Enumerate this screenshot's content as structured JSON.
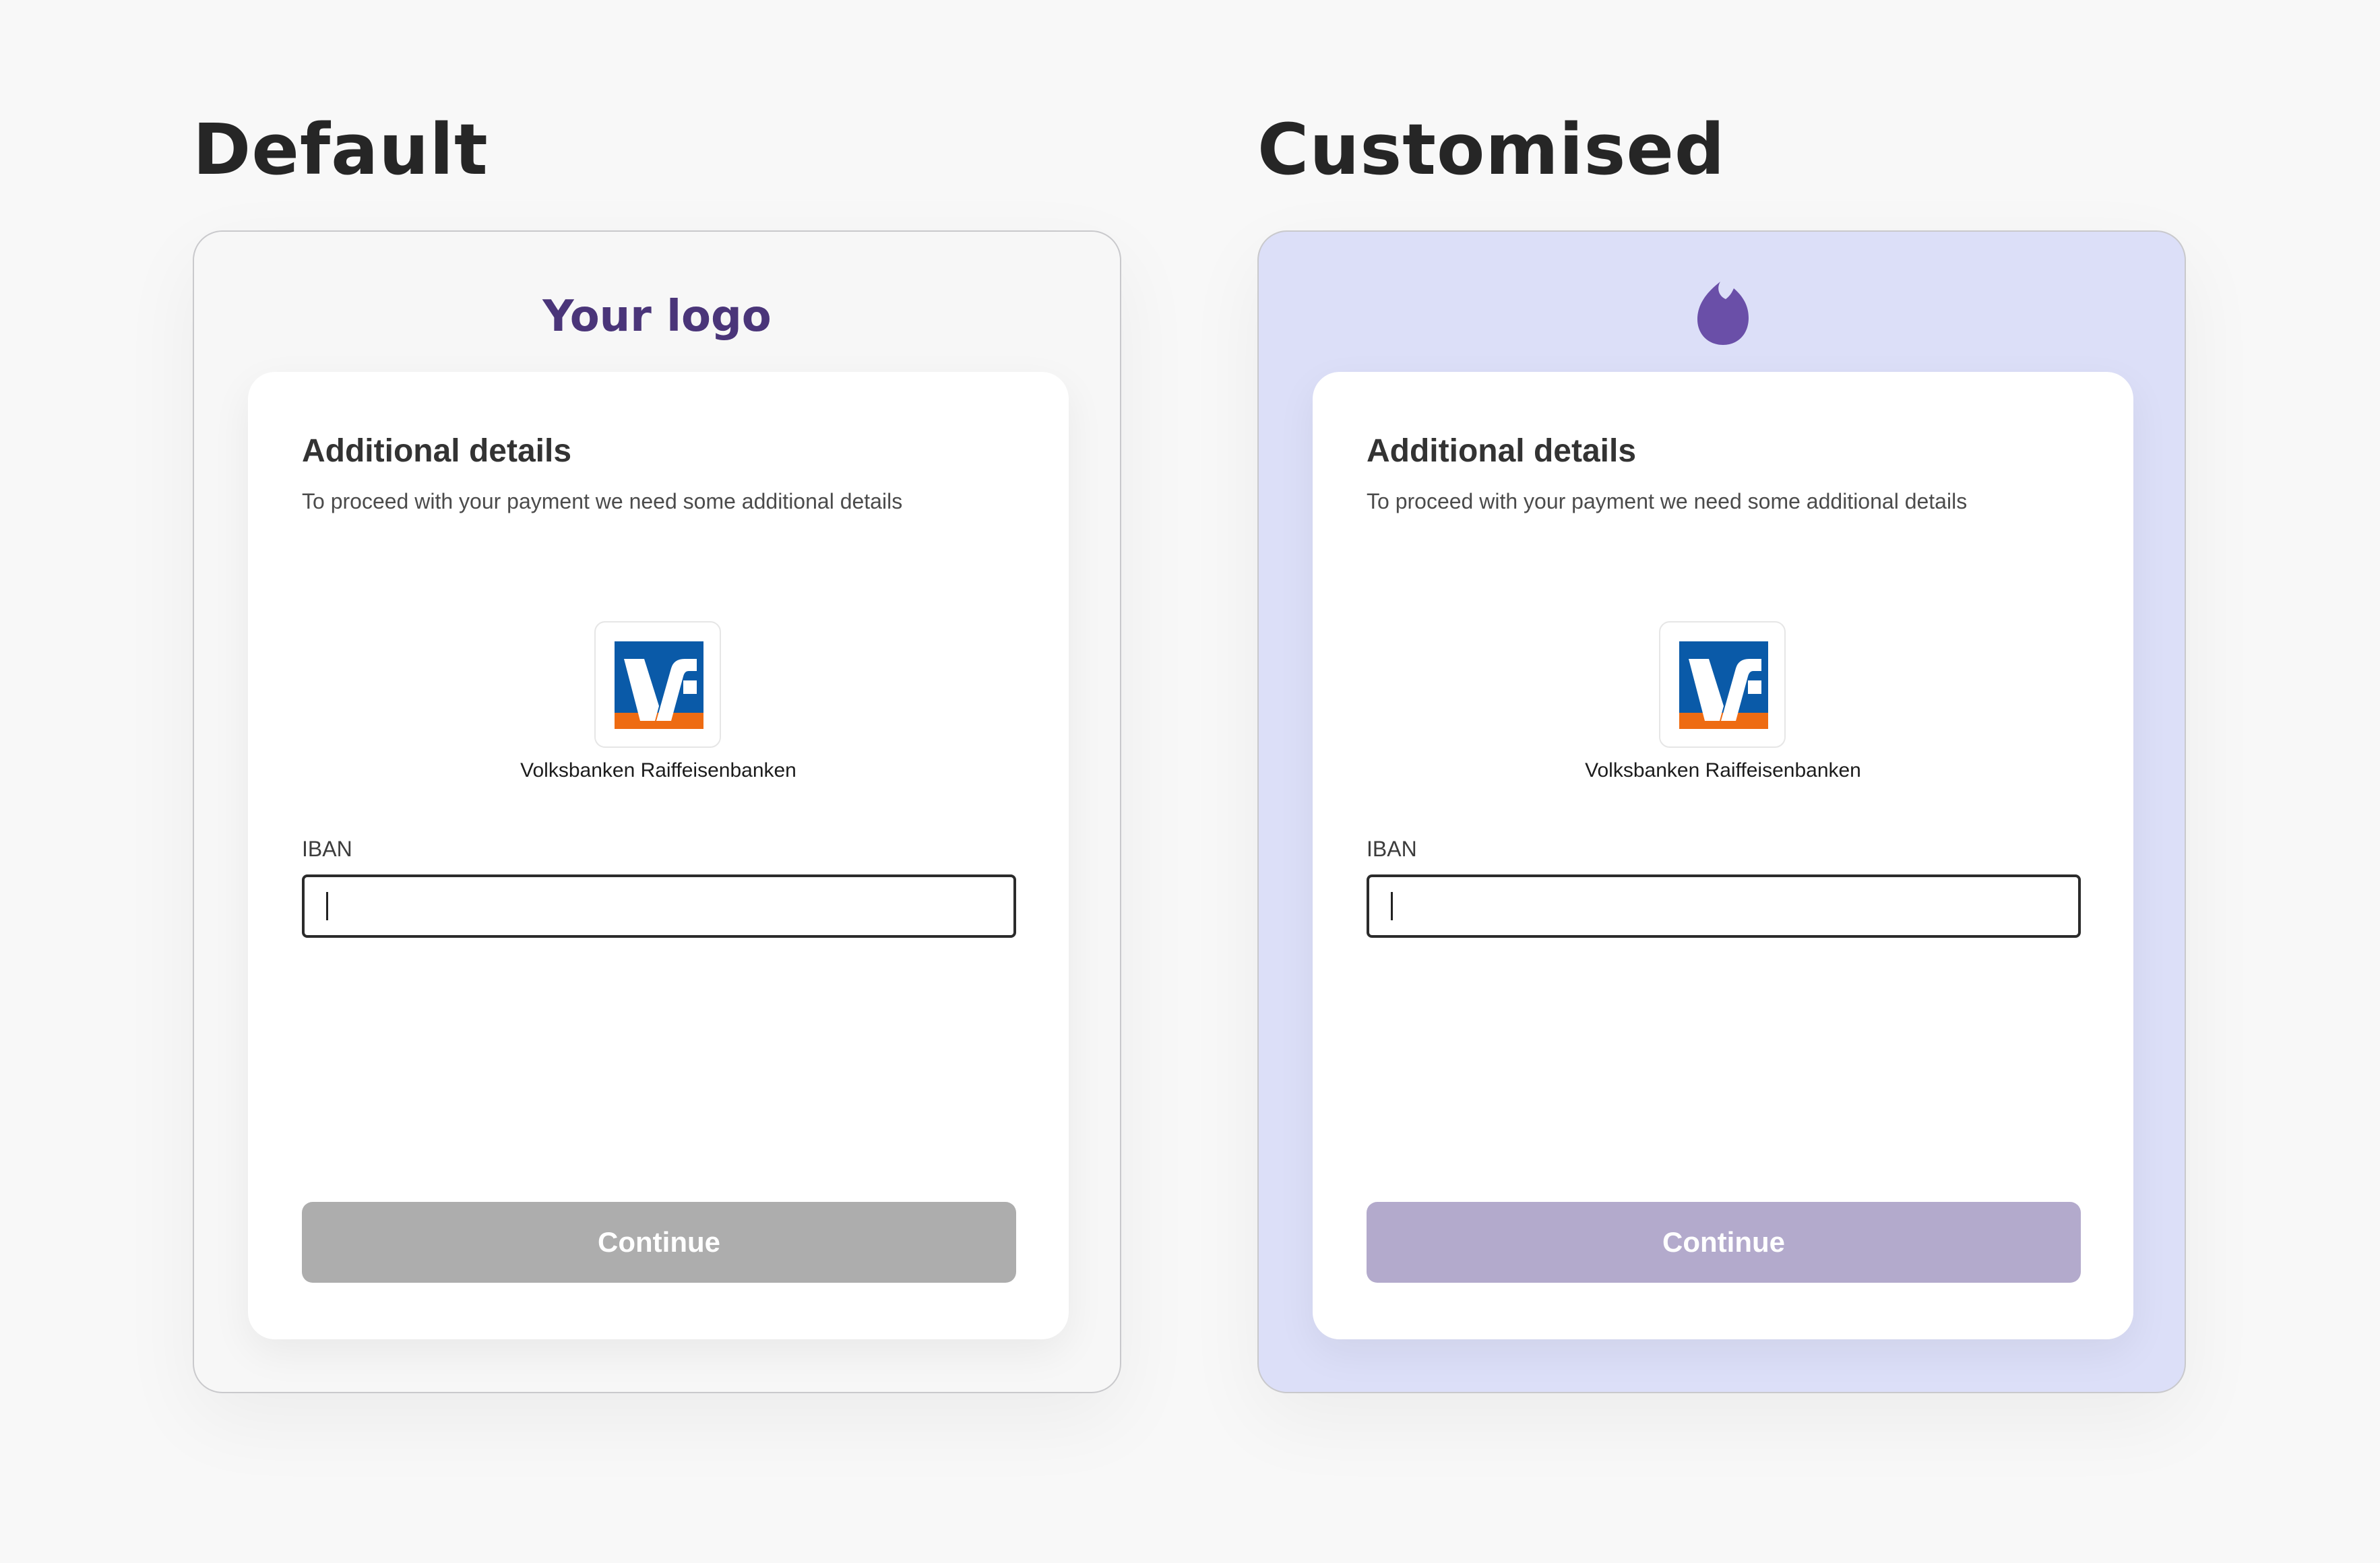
{
  "panels": [
    {
      "heading": "Default",
      "logo_text": "Your logo",
      "card": {
        "title": "Additional details",
        "subtitle": "To proceed with your payment we need some additional details",
        "bank_name": "Volksbanken Raiffeisenbanken",
        "iban_label": "IBAN",
        "iban_value": "",
        "continue_label": "Continue"
      },
      "colors": {
        "frame_bg": "#f7f7f7",
        "logo_text": "#4a3579",
        "button_bg": "#adadad"
      }
    },
    {
      "heading": "Customised",
      "logo_icon": "flame-drop-icon",
      "card": {
        "title": "Additional details",
        "subtitle": "To proceed with your payment we need some additional details",
        "bank_name": "Volksbanken Raiffeisenbanken",
        "iban_label": "IBAN",
        "iban_value": "",
        "continue_label": "Continue"
      },
      "colors": {
        "frame_bg": "#dcdff8",
        "logo_icon": "#6a4fa8",
        "button_bg": "#b3aacc"
      }
    }
  ],
  "bank_logo": {
    "icon": "volksbank-logo-icon",
    "blue": "#0a5aa8",
    "orange": "#ee6b12"
  }
}
